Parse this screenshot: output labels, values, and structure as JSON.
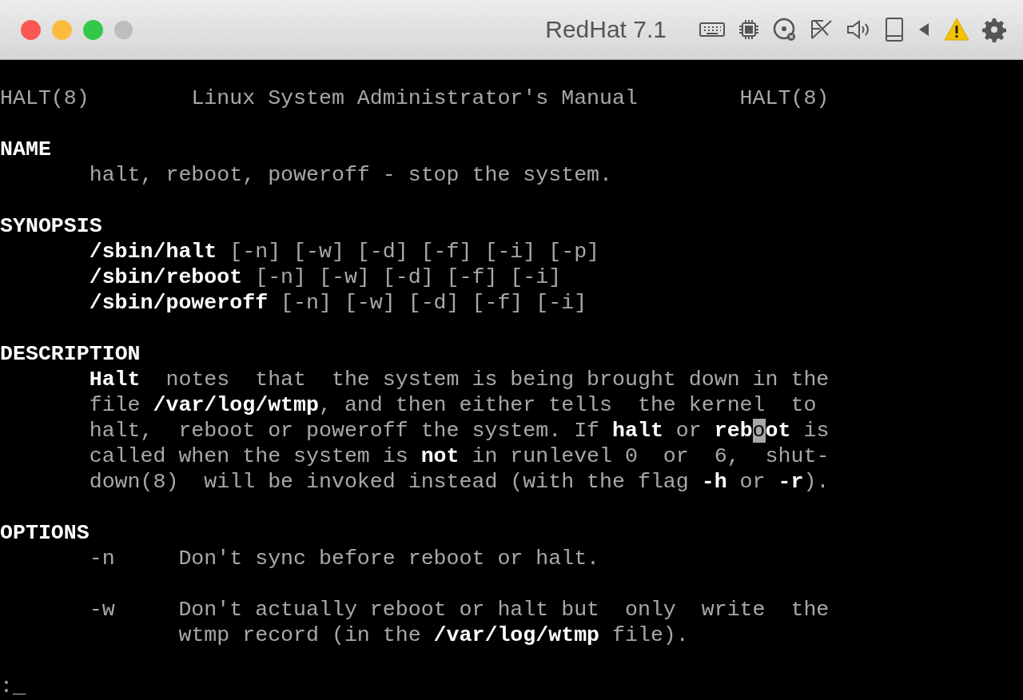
{
  "window": {
    "title": "RedHat 7.1"
  },
  "terminal": {
    "header": {
      "left": "HALT(8)",
      "center": "Linux System Administrator's Manual",
      "right": "HALT(8)"
    },
    "blocks": [
      [
        {
          "kind": "heading",
          "text": "NAME"
        },
        {
          "kind": "body",
          "text": "halt, reboot, poweroff - stop the system."
        }
      ],
      [
        {
          "kind": "heading",
          "text": "SYNOPSIS"
        },
        {
          "kind": "body",
          "text": "**/sbin/halt** [-n] [-w] [-d] [-f] [-i] [-p]"
        },
        {
          "kind": "body",
          "text": "**/sbin/reboot** [-n] [-w] [-d] [-f] [-i]"
        },
        {
          "kind": "body",
          "text": "**/sbin/poweroff** [-n] [-w] [-d] [-f] [-i]"
        }
      ],
      [
        {
          "kind": "heading",
          "text": "DESCRIPTION"
        },
        {
          "kind": "body",
          "text": "**Halt**  notes  that  the system is being brought down in the"
        },
        {
          "kind": "body",
          "text": "file **/var/log/wtmp**, and then either tells  the kernel  to"
        },
        {
          "kind": "body",
          "text": "halt,  reboot or poweroff the system. If **halt** or **reb**",
          "cursor": "o",
          "after": "**ot** is"
        },
        {
          "kind": "body",
          "text": "called when the system is **not** in runlevel 0  or  6,  shut-"
        },
        {
          "kind": "body",
          "text": "down(8)  will be invoked instead (with the flag **-h** or **-r**)."
        }
      ],
      [
        {
          "kind": "heading",
          "text": "OPTIONS"
        },
        {
          "kind": "body",
          "text": "-n     Don't sync before reboot or halt."
        }
      ],
      [
        {
          "kind": "body",
          "text": "-w     Don't actually reboot or halt but  only  write  the"
        },
        {
          "kind": "continuation",
          "text": "wtmp record (in the **/var/log/wtmp** file)."
        }
      ]
    ],
    "prompt": ":_"
  }
}
